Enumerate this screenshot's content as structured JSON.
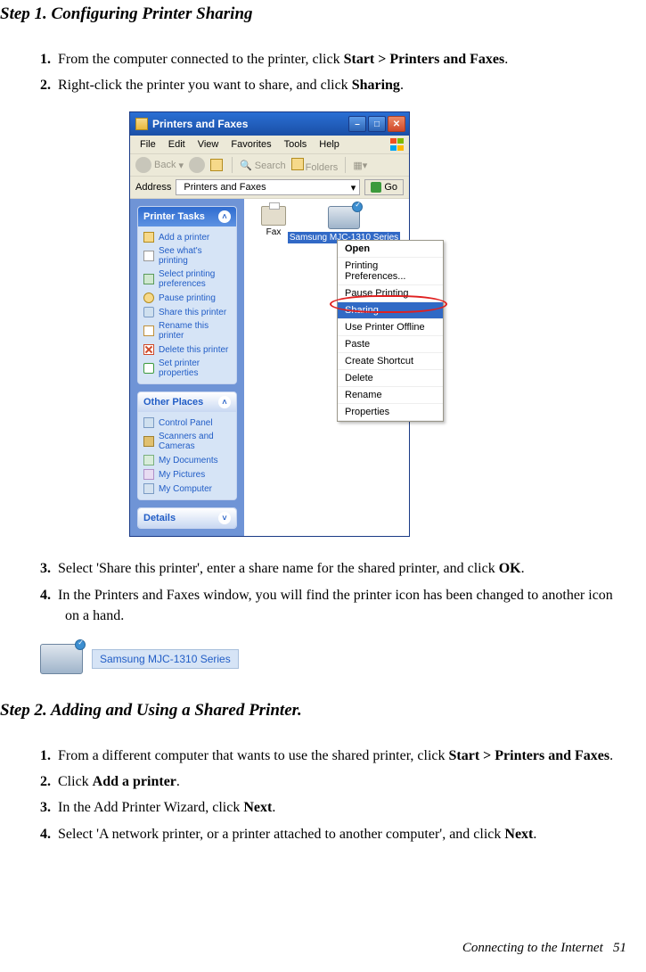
{
  "headings": {
    "step1": "Step 1. Configuring Printer Sharing",
    "step2": "Step 2. Adding and Using a Shared Printer."
  },
  "step1": {
    "items": [
      {
        "num": "1.",
        "prefix": "From the computer connected to the printer, click ",
        "bold": "Start > Printers and Faxes",
        "suffix": "."
      },
      {
        "num": "2.",
        "prefix": "Right-click the printer you want to share, and click ",
        "bold": "Sharing",
        "suffix": "."
      },
      {
        "num": "3.",
        "prefix": "Select 'Share this printer', enter a share name for the shared printer, and click ",
        "bold": "OK",
        "suffix": "."
      },
      {
        "num": "4.",
        "prefix": "In the Printers and Faxes window, you will find the printer icon has been changed to another icon on a hand.",
        "bold": "",
        "suffix": ""
      }
    ]
  },
  "step2": {
    "items": [
      {
        "num": "1.",
        "prefix": "From a different computer that wants to use the shared printer, click ",
        "bold": "Start > Printers and Faxes",
        "suffix": "."
      },
      {
        "num": "2.",
        "prefix": "Click ",
        "bold": "Add a printer",
        "suffix": "."
      },
      {
        "num": "3.",
        "prefix": "In the Add Printer Wizard, click ",
        "bold": "Next",
        "suffix": "."
      },
      {
        "num": "4.",
        "prefix": "Select 'A network printer, or a printer attached to another computer', and click ",
        "bold": "Next",
        "suffix": "."
      }
    ]
  },
  "xp": {
    "title": "Printers and Faxes",
    "menu": [
      "File",
      "Edit",
      "View",
      "Favorites",
      "Tools",
      "Help"
    ],
    "toolbar": {
      "back": "Back",
      "search": "Search",
      "folders": "Folders"
    },
    "addr": {
      "label": "Address",
      "value": "Printers and Faxes",
      "go": "Go"
    },
    "panel1": {
      "title": "Printer Tasks",
      "links": [
        "Add a printer",
        "See what's printing",
        "Select printing preferences",
        "Pause printing",
        "Share this printer",
        "Rename this printer",
        "Delete this printer",
        "Set printer properties"
      ]
    },
    "panel2": {
      "title": "Other Places",
      "links": [
        "Control Panel",
        "Scanners and Cameras",
        "My Documents",
        "My Pictures",
        "My Computer"
      ]
    },
    "panel3": {
      "title": "Details"
    },
    "main": {
      "fax": "Fax",
      "printer": "Samsung MJC-1310 Series"
    },
    "ctx": [
      "Open",
      "Printing Preferences...",
      "Pause Printing",
      "Sharing...",
      "Use Printer Offline",
      "Paste",
      "Create Shortcut",
      "Delete",
      "Rename",
      "Properties"
    ]
  },
  "sharedLabel": "Samsung MJC-1310 Series",
  "footer": {
    "text": "Connecting to the Internet",
    "page": "51"
  }
}
